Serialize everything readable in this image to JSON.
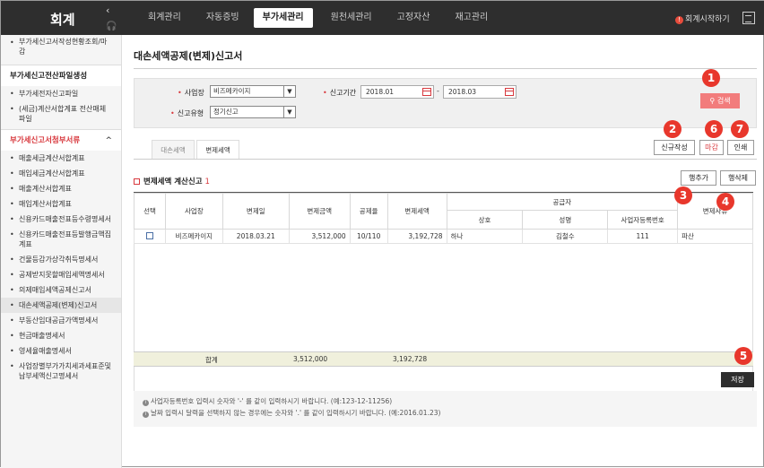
{
  "app": {
    "brand": "회계",
    "collapse": "‹",
    "start_link": "회계시작하기",
    "start_info": "!"
  },
  "nav": [
    "회계관리",
    "자동증빙",
    "부가세관리",
    "원천세관리",
    "고정자산",
    "재고관리"
  ],
  "sidebar": {
    "top_items": [
      "부가세신고서작성현황조회/마감"
    ],
    "group1": {
      "title": "부가세신고전산파일생성",
      "items": [
        "부가세전자신고파일",
        "(세금)계산서합계표 전산매체파일"
      ]
    },
    "group2": {
      "title": "부가세신고서첨부서류",
      "chevron": "^",
      "items": [
        "매출세금계산서합계표",
        "매입세금계산서합계표",
        "매출계산서합계표",
        "매입계산서합계표",
        "신용카드매출전표등수령명세서",
        "신용카드매출전표등발행금액집계표",
        "건물등감가상각취득명세서",
        "공제받지못할매입세액명세서",
        "의제매입세액공제신고서",
        "대손세액공제(변제)신고서",
        "부동산임대공급가액명세서",
        "현금매출명세서",
        "영세율매출명세서",
        "사업장별부가가치세과세표준및납부세액신고명세서"
      ]
    }
  },
  "page": {
    "title": "대손세액공제(변제)신고서"
  },
  "form": {
    "business_label": "사업장",
    "business_value": "비즈메카이지",
    "period_label": "신고기간",
    "period_from": "2018.01",
    "period_to": "2018.03",
    "period_sep": "-",
    "type_label": "신고유형",
    "type_value": "정기신고",
    "search_label": "검색"
  },
  "tabs": [
    "대손세액",
    "변제세액"
  ],
  "buttons": {
    "new": "신규작성",
    "close": "마감",
    "print": "인쇄",
    "add_row": "행추가",
    "delete_row": "행삭제",
    "save": "저장"
  },
  "section": {
    "title": "변제세액 계산신고",
    "count": "1"
  },
  "table": {
    "headers": {
      "select": "선택",
      "business": "사업장",
      "date": "변제일",
      "amount": "변제금액",
      "rate": "공제율",
      "tax": "변제세액",
      "supplier": "공급자",
      "name": "상호",
      "rep": "성명",
      "regno": "사업자등록번호",
      "reason": "변제사유"
    },
    "rows": [
      {
        "business": "비즈메카이지",
        "date": "2018.03.21",
        "amount": "3,512,000",
        "rate": "10/110",
        "tax": "3,192,728",
        "name": "하나",
        "rep": "김철수",
        "regno": "111",
        "reason": "파산"
      }
    ],
    "sum": {
      "label": "합계",
      "amount": "3,512,000",
      "tax": "3,192,728"
    }
  },
  "notes": [
    "사업자등록번호 입력시 숫자와 '-' 를 같이 입력하시기 바랍니다. (예:123-12-11256)",
    "날짜 입력시 달력을 선택하지 않는 경우에는 숫자와 '.' 를 같이 입력하시기 바랍니다. (예:2016.01.23)"
  ],
  "callouts": [
    "1",
    "2",
    "3",
    "4",
    "5",
    "6",
    "7"
  ],
  "colors": {
    "accent": "#d8393e",
    "callout": "#e8372c",
    "topbar": "#2e2e2e"
  }
}
